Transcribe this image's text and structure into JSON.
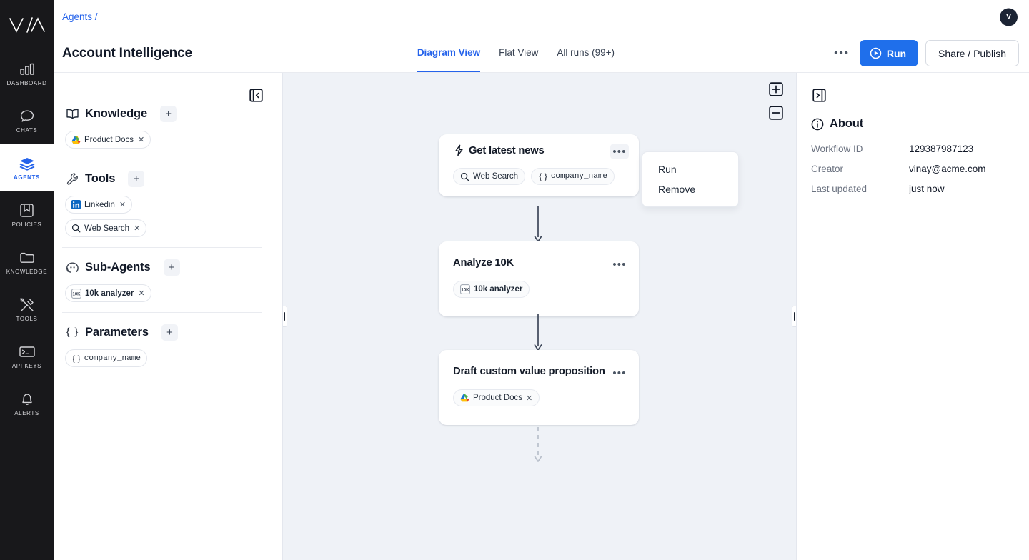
{
  "rail": {
    "logo_alt": "vianai-logo",
    "items": [
      {
        "label": "DASHBOARD",
        "icon": "bar-chart-icon",
        "active": false
      },
      {
        "label": "CHATS",
        "icon": "chat-bubble-icon",
        "active": false
      },
      {
        "label": "AGENTS",
        "icon": "layers-icon",
        "active": true
      },
      {
        "label": "POLICIES",
        "icon": "bookmark-icon",
        "active": false
      },
      {
        "label": "KNOWLEDGE",
        "icon": "folder-icon",
        "active": false
      },
      {
        "label": "TOOLS",
        "icon": "tools-icon",
        "active": false
      },
      {
        "label": "API KEYS",
        "icon": "terminal-icon",
        "active": false
      },
      {
        "label": "ALERTS",
        "icon": "bell-icon",
        "active": false
      }
    ]
  },
  "header": {
    "breadcrumb": "Agents /",
    "avatar_initial": "V",
    "page_title": "Account Intelligence",
    "tabs": [
      {
        "label": "Diagram View",
        "active": true
      },
      {
        "label": "Flat View",
        "active": false
      },
      {
        "label": "All runs (99+)",
        "active": false
      }
    ],
    "more_label": "•••",
    "run_label": "Run",
    "share_label": "Share / Publish",
    "accent_color": "#1f6feb"
  },
  "config_panel": {
    "collapse_icon": "panel-collapse-left-icon",
    "add_label": "+",
    "sections": [
      {
        "title": "Knowledge",
        "icon": "book-icon",
        "chips": [
          {
            "label": "Product Docs",
            "icon": "google-drive-icon",
            "removable": true
          }
        ]
      },
      {
        "title": "Tools",
        "icon": "wrench-icon",
        "chips": [
          {
            "label": "Linkedin",
            "icon": "linkedin-icon",
            "removable": true
          },
          {
            "label": "Web Search",
            "icon": "search-icon",
            "removable": true
          }
        ]
      },
      {
        "title": "Sub-Agents",
        "icon": "agent-face-icon",
        "chips": [
          {
            "label": "10k analyzer",
            "icon": "tenk-icon",
            "removable": true
          }
        ]
      },
      {
        "title": "Parameters",
        "icon": "braces-icon",
        "chips": [
          {
            "label": "company_name",
            "icon": "braces-icon",
            "removable": false
          }
        ]
      }
    ]
  },
  "canvas": {
    "background_color": "#eff2f7",
    "zoom_in_label": "+",
    "zoom_out_label": "−",
    "grip_left_name": "resize-handle-left",
    "grip_right_name": "resize-handle-right",
    "nodes": [
      {
        "title": "Get latest news",
        "icon": "lightning-bolt-icon",
        "menu_open": true,
        "chips": [
          {
            "label": "Web Search",
            "icon": "search-icon",
            "removable": false
          },
          {
            "label": "company_name",
            "icon": "braces-icon",
            "removable": false
          }
        ]
      },
      {
        "title": "Analyze 10K",
        "icon": null,
        "menu_open": false,
        "chips": [
          {
            "label": "10k analyzer",
            "icon": "tenk-icon",
            "removable": false
          }
        ]
      },
      {
        "title": "Draft custom value proposition",
        "icon": null,
        "menu_open": false,
        "chips": [
          {
            "label": "Product Docs",
            "icon": "google-drive-icon",
            "removable": true
          }
        ]
      }
    ],
    "context_menu": {
      "items": [
        "Run",
        "Remove"
      ]
    }
  },
  "about_panel": {
    "expand_icon": "panel-expand-right-icon",
    "title": "About",
    "icon": "info-icon",
    "rows": [
      {
        "key": "Workflow ID",
        "value": "129387987123"
      },
      {
        "key": "Creator",
        "value": "vinay@acme.com"
      },
      {
        "key": "Last updated",
        "value": "just now"
      }
    ]
  }
}
